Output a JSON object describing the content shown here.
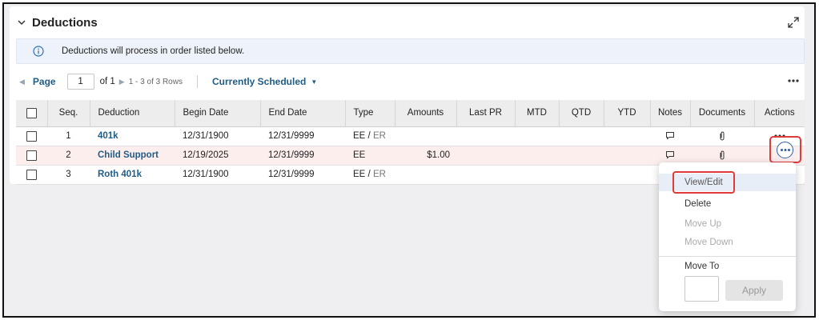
{
  "section": {
    "title": "Deductions"
  },
  "info_banner": {
    "text": "Deductions will process in order listed below."
  },
  "pager": {
    "page_label": "Page",
    "page_value": "1",
    "of_text": "of 1",
    "rows_text": "1 - 3 of 3 Rows",
    "filter_label": "Currently Scheduled"
  },
  "table": {
    "headers": [
      "Seq.",
      "Deduction",
      "Begin Date",
      "End Date",
      "Type",
      "Amounts",
      "Last PR",
      "MTD",
      "QTD",
      "YTD",
      "Notes",
      "Documents",
      "Actions"
    ],
    "rows": [
      {
        "seq": "1",
        "deduction": "401k",
        "begin": "12/31/1900",
        "end": "12/31/9999",
        "type_ee": "EE",
        "type_sep": " / ",
        "type_er": "ER",
        "amount": ""
      },
      {
        "seq": "2",
        "deduction": "Child Support",
        "begin": "12/19/2025",
        "end": "12/31/9999",
        "type_ee": "EE",
        "type_sep": "",
        "type_er": "",
        "amount": "$1.00"
      },
      {
        "seq": "3",
        "deduction": "Roth 401k",
        "begin": "12/31/1900",
        "end": "12/31/9999",
        "type_ee": "EE",
        "type_sep": " / ",
        "type_er": "ER",
        "amount": ""
      }
    ]
  },
  "actions_menu": {
    "view_edit": "View/Edit",
    "delete": "Delete",
    "move_up": "Move Up",
    "move_down": "Move Down",
    "move_to": "Move To",
    "apply": "Apply"
  },
  "colors": {
    "link": "#1f5c86",
    "highlight": "#e03b3b",
    "selected_row": "#fdeeee"
  }
}
